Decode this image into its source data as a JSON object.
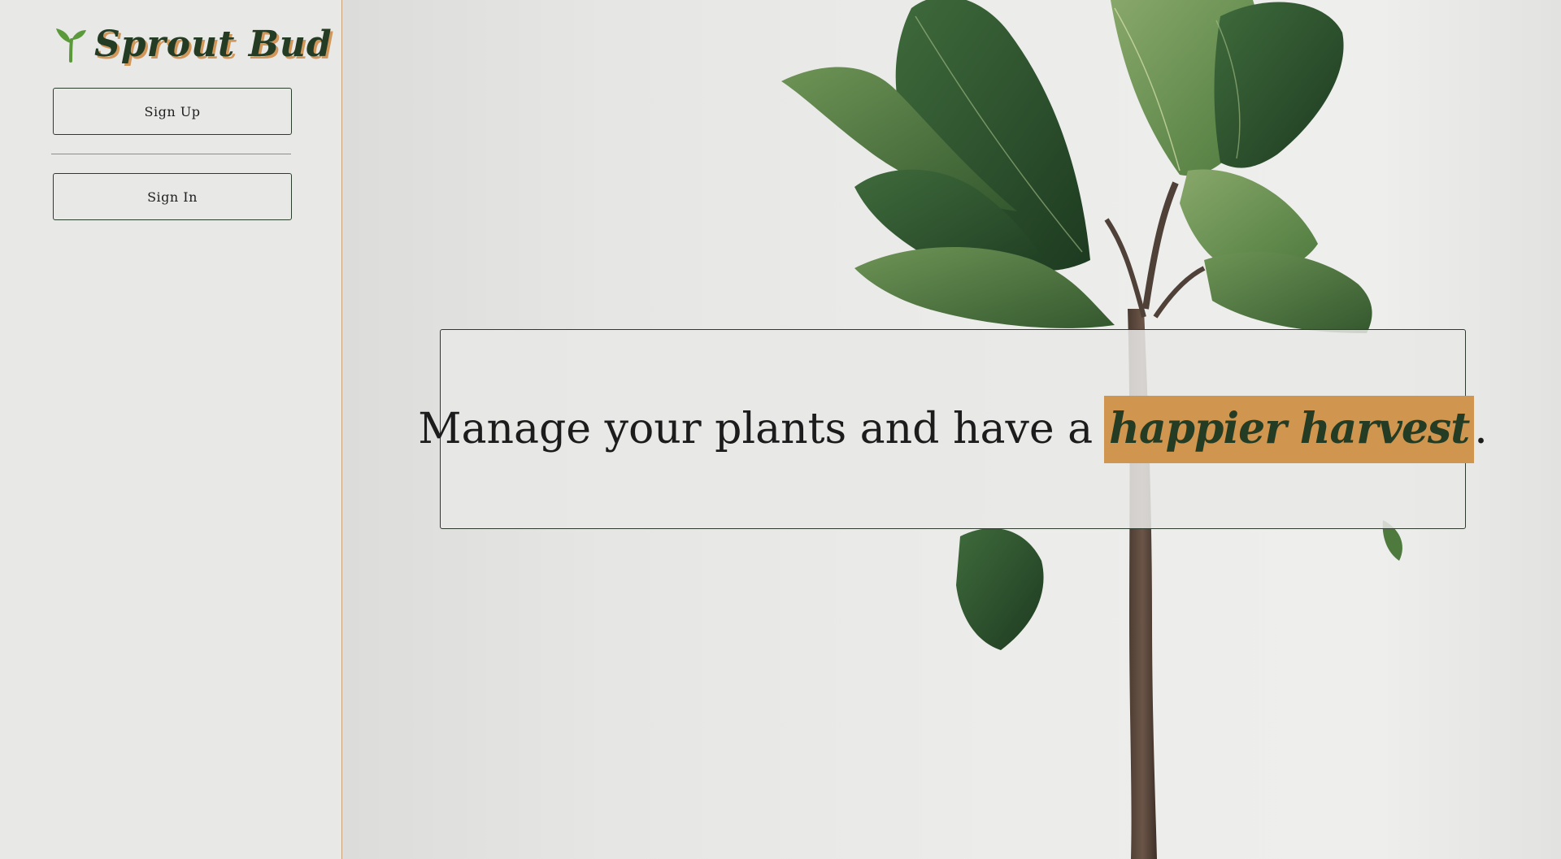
{
  "brand": {
    "name": "Sprout Bud",
    "icon": "sprout-icon"
  },
  "sidebar": {
    "sign_up_label": "Sign Up",
    "sign_in_label": "Sign In"
  },
  "hero": {
    "headline_prefix": "Manage your plants and have a",
    "headline_highlight": "happier harvest",
    "headline_suffix": ".",
    "background_image": "fiddle-leaf-fig-plant-photo"
  },
  "colors": {
    "brand_green": "#243c24",
    "brand_orange": "#d0954f",
    "sprout_green": "#5a9a3a",
    "background": "#e8e8e6"
  }
}
